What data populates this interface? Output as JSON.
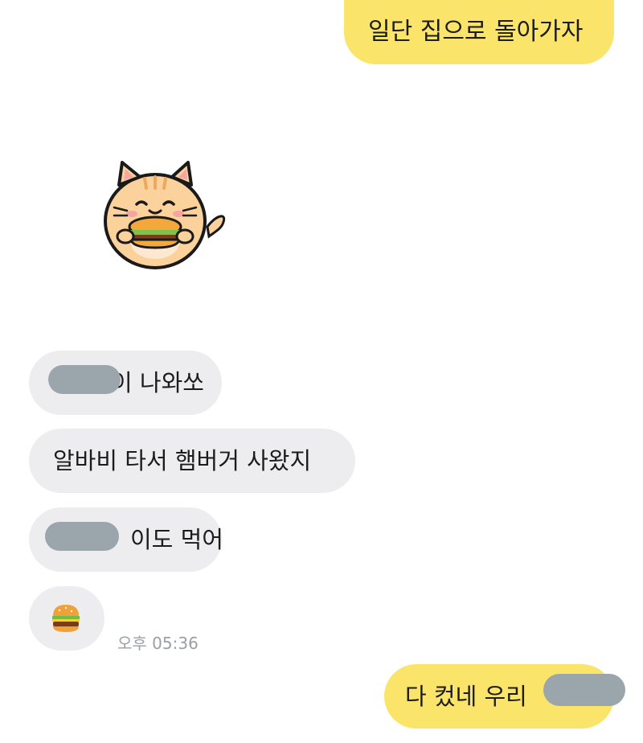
{
  "messages": {
    "out_1": "일단 집으로 돌아가자",
    "in_1_visible": "이 나와쏘",
    "in_2": "알바비 타서 햄버거 사왔지",
    "in_3_visible": "이도 먹어",
    "in_4_emoji_name": "hamburger-icon",
    "in_4_time": "오후 05:36",
    "out_2_visible": "다 컸네 우리"
  },
  "sticker": {
    "name": "cat-eating-hamburger-sticker"
  },
  "colors": {
    "outgoing_bubble": "#fbe46a",
    "incoming_bubble": "#ededef",
    "redaction": "#9aa6ac",
    "timestamp": "#9a9fa6"
  }
}
